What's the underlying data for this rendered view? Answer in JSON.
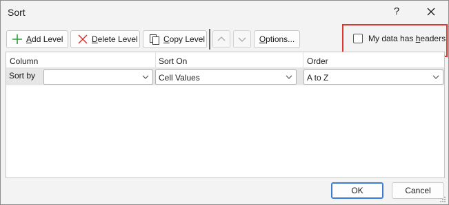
{
  "window": {
    "title": "Sort",
    "help_label": "?"
  },
  "toolbar": {
    "add_level": {
      "label_ul": "A",
      "label_rest": "dd Level",
      "icon": "plus-icon"
    },
    "delete_level": {
      "label_ul": "D",
      "label_rest": "elete Level",
      "icon": "x-icon"
    },
    "copy_level": {
      "label_ul": "C",
      "label_rest": "opy Level",
      "icon": "copy-icon"
    },
    "move_up": {
      "icon": "chevron-up-icon"
    },
    "move_down": {
      "icon": "chevron-down-icon"
    },
    "options": {
      "label_ul": "O",
      "label_rest": "ptions..."
    }
  },
  "headers_checkbox": {
    "label_pre": "My data has ",
    "label_ul": "h",
    "label_rest": "eaders",
    "checked": false
  },
  "grid": {
    "columns": [
      "Column",
      "Sort On",
      "Order"
    ],
    "row": {
      "label": "Sort by",
      "column_value": "",
      "sort_on_value": "Cell Values",
      "order_value": "A to Z"
    }
  },
  "footer": {
    "ok_label": "OK",
    "cancel_label": "Cancel"
  },
  "colors": {
    "highlight": "#e0342f",
    "plus_green": "#2e9b3e",
    "x_red": "#d9312b",
    "ok_border": "#3a7bd5"
  }
}
